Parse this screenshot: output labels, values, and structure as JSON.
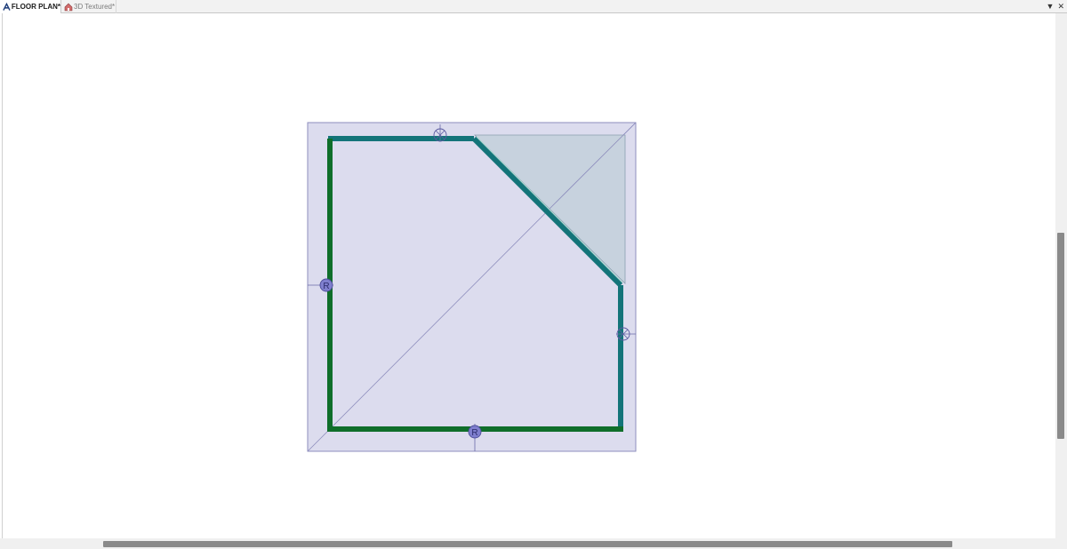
{
  "tabs": [
    {
      "label": "FLOOR PLAN*",
      "icon": "floor-plan-icon",
      "active": true
    },
    {
      "label": "3D Textured*",
      "icon": "house-3d-icon",
      "active": false
    }
  ],
  "controls": {
    "dropdown_glyph": "▼",
    "close_glyph": "✕"
  },
  "markers": {
    "bottom_label": "R",
    "left_label": "R"
  },
  "colors": {
    "wall_teal": "#137479",
    "wall_green": "#0f6e2a",
    "room_fill": "#dcdcee",
    "room_border": "#8e8ebd",
    "roof_fill": "#c4d0dc",
    "marker_fill": "#7f7fce"
  }
}
